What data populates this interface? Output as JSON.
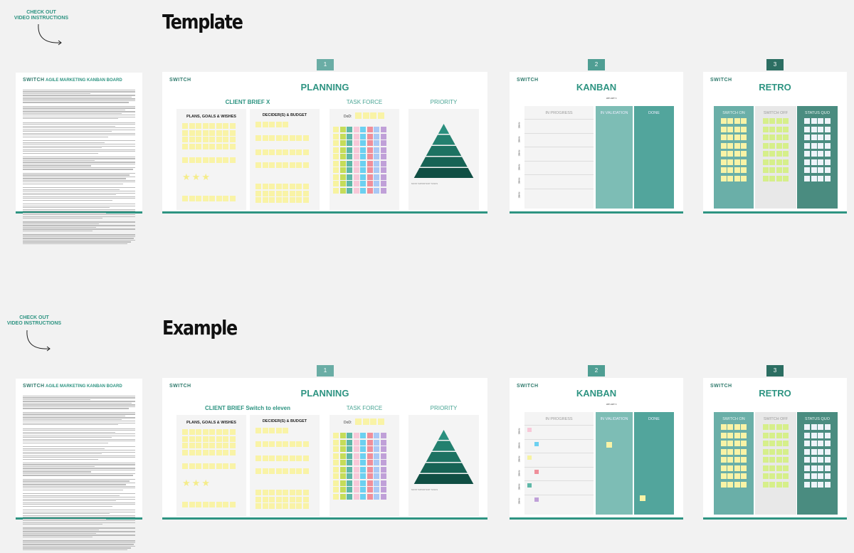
{
  "colors": {
    "accent": "#2e9482",
    "tab1": "#6aada5",
    "tab2": "#4f9e93",
    "tab3": "#2c6e62",
    "sticky_yellow": "#f9f3a6",
    "in_validation": "#7dbdb5",
    "done": "#52a59c",
    "switch_on": "#6aafa8",
    "switch_off": "#e8e8e8",
    "status_quo": "#4a8c80",
    "taskforce": [
      "#f7f3a0",
      "#c5dc5a",
      "#5fb8a8",
      "#f8c8d8",
      "#6cd0f0",
      "#ef8f9a",
      "#a9c8f5",
      "#c0a0d8"
    ]
  },
  "sections": [
    {
      "title": "Template",
      "checkout": "CHECK OUT\nVIDEO INSTRUCTIONS",
      "client_brief": "CLIENT BRIEF X"
    },
    {
      "title": "Example",
      "checkout": "CHECK OUT\nVIDEO INSTRUCTIONS",
      "client_brief": "CLIENT BRIEF Switch to eleven"
    }
  ],
  "doc": {
    "logo": "SWITCH",
    "title": "AGILE MARKETING KANBAN BOARD"
  },
  "planning": {
    "tab": "1",
    "logo": "SWITCH",
    "title": "PLANNING",
    "task_force": "TASK FORCE",
    "priority": "PRIORITY",
    "plans_title": "PLANS, GOALS & WISHES",
    "decider_title": "DECIDER(S) & BUDGET",
    "dod_label": "DoD:",
    "most_important": "MOST IMPORTANT TASKS"
  },
  "kanban": {
    "tab": "2",
    "logo": "SWITCH",
    "title": "KANBAN",
    "wip_limit": "WIP LIMIT: 6",
    "columns": [
      "IN PROGRESS",
      "IN VALIDATION",
      "DONE"
    ],
    "row_label": "NAME"
  },
  "retro": {
    "tab": "3",
    "logo": "SWITCH",
    "title": "RETRO",
    "columns": [
      "SWITCH ON",
      "SWITCH OFF",
      "STATUS QUO"
    ]
  }
}
